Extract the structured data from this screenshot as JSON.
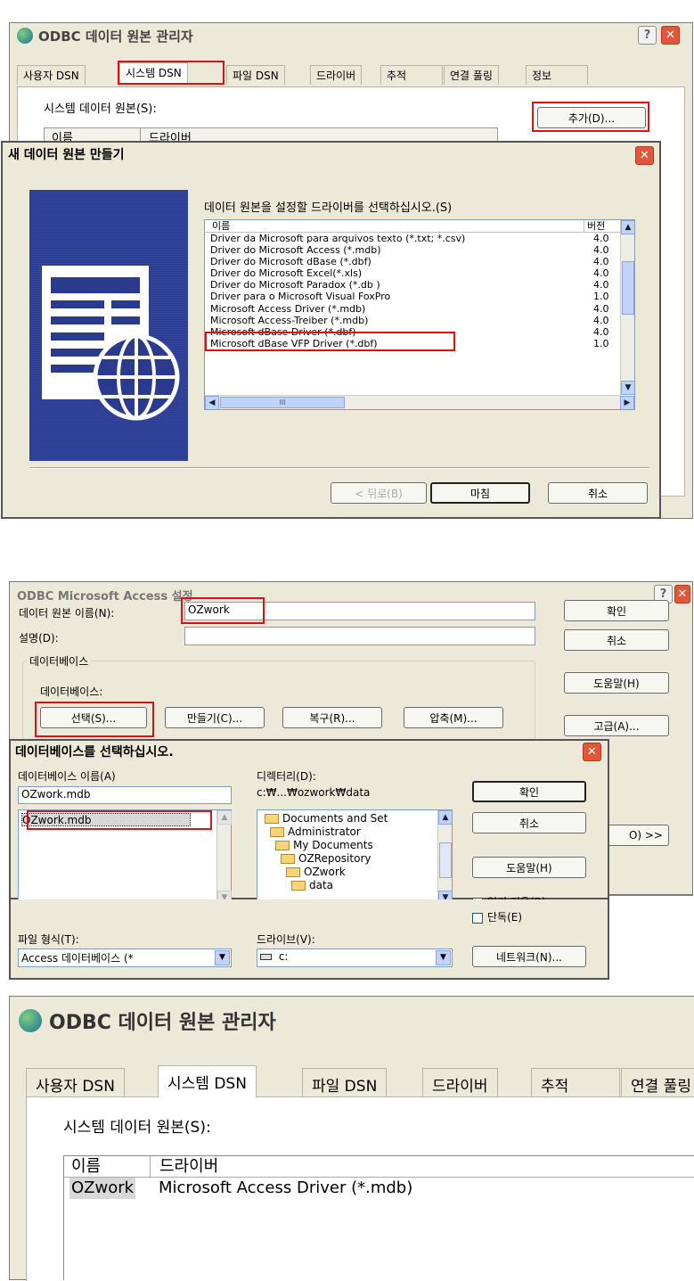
{
  "section1": {
    "title": "ODBC 데이터 원본 관리자",
    "tabs": [
      "사용자 DSN",
      "시스템 DSN",
      "파일 DSN",
      "드라이버",
      "추적",
      "연결 풀링",
      "정보"
    ],
    "data_sources_label": "시스템 데이터 원본(S):",
    "columns": [
      "이름",
      "드라이버"
    ],
    "add_button": "추가(D)...",
    "inner_dialog": {
      "title": "새 데이터 원본 만들기",
      "instruction": "데이터 원본을 설정할 드라이버를 선택하십시오.(S)",
      "list_columns": [
        "이름",
        "버전"
      ],
      "drivers": [
        {
          "name": "Driver da Microsoft para arquivos texto (*.txt; *.csv)",
          "version": "4.0"
        },
        {
          "name": "Driver do Microsoft Access (*.mdb)",
          "version": "4.0"
        },
        {
          "name": "Driver do Microsoft dBase (*.dbf)",
          "version": "4.0"
        },
        {
          "name": "Driver do Microsoft Excel(*.xls)",
          "version": "4.0"
        },
        {
          "name": "Driver do Microsoft Paradox (*.db )",
          "version": "4.0"
        },
        {
          "name": "Driver para o Microsoft Visual FoxPro",
          "version": "1.0"
        },
        {
          "name": "Microsoft Access Driver (*.mdb)",
          "version": "4.0"
        },
        {
          "name": "Microsoft Access-Treiber (*.mdb)",
          "version": "4.0"
        },
        {
          "name": "Microsoft dBase Driver (*.dbf)",
          "version": "4.0"
        },
        {
          "name": "Microsoft dBase VFP Driver (*.dbf)",
          "version": "1.0"
        }
      ],
      "back_button": "< 뒤로(B)",
      "finish_button": "마침",
      "cancel_button": "취소",
      "scroll_mark": "III"
    }
  },
  "section2": {
    "title": "ODBC Microsoft Access 설정",
    "dsn_label": "데이터 원본 이름(N):",
    "dsn_value": "OZwork",
    "desc_label": "설명(D):",
    "desc_value": "",
    "db_group": "데이터베이스",
    "db_label": "데이터베이스:",
    "buttons": [
      "선택(S)...",
      "만들기(C)...",
      "복구(R)...",
      "압축(M)..."
    ],
    "side_buttons": [
      "확인",
      "취소",
      "도움말(H)",
      "고급(A)..."
    ],
    "options_button": "O) >>",
    "inner_dialog": {
      "title": "데이터베이스를 선택하십시오.",
      "db_name_label": "데이터베이스 이름(A)",
      "db_name_value": "OZwork.mdb",
      "files": [
        "OZwork.mdb"
      ],
      "dir_label": "디렉터리(D):",
      "dir_value": "c:₩...₩ozwork₩data",
      "folders": [
        "Documents and Set",
        "Administrator",
        "My Documents",
        "OZRepository",
        "OZwork",
        "data"
      ],
      "ok": "확인",
      "cancel": "취소",
      "help": "도움말(H)",
      "readonly": "읽기 전용(R)",
      "exclusive": "단독(E)",
      "filetype_label": "파일 형식(T):",
      "filetype_value": "Access 데이터베이스 (*",
      "drive_label": "드라이브(V):",
      "drive_value": "c:",
      "network": "네트워크(N)..."
    }
  },
  "section3": {
    "title": "ODBC 데이터 원본 관리자",
    "tabs": [
      "사용자 DSN",
      "시스템 DSN",
      "파일 DSN",
      "드라이버",
      "추적",
      "연결 풀링"
    ],
    "data_sources_label": "시스템 데이터 원본(S):",
    "columns": [
      "이름",
      "드라이버"
    ],
    "rows": [
      {
        "name": "OZwork",
        "driver": "Microsoft Access Driver (*.mdb)"
      }
    ]
  },
  "colors": {
    "highlight_red": "#e01010",
    "dialog_bg": "#ece9d8",
    "banner_blue": "#2a3a8c"
  }
}
